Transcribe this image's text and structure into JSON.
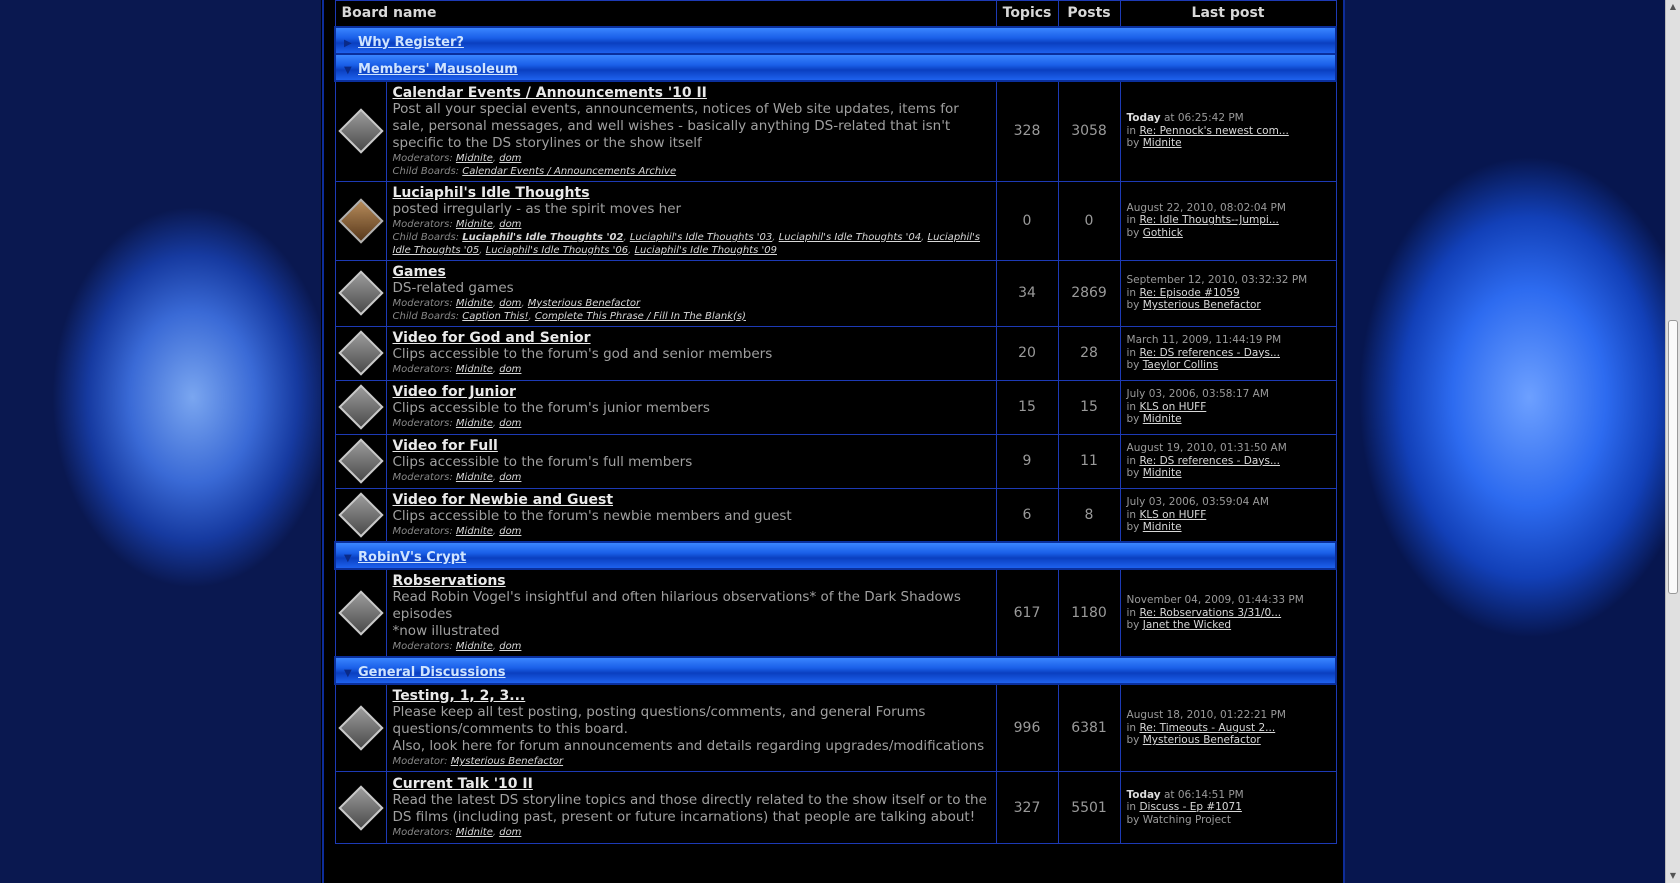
{
  "header": {
    "board_name": "Board name",
    "topics": "Topics",
    "posts": "Posts",
    "last_post": "Last post"
  },
  "categories": {
    "why_register": "Why Register?",
    "members_mausoleum": "Members' Mausoleum",
    "robinv_crypt": "RobinV's Crypt",
    "general_discussions": "General Discussions"
  },
  "labels": {
    "moderators": "Moderators:",
    "moderator": "Moderator:",
    "child_boards": "Child Boards:",
    "in": "in",
    "by": "by",
    "today": "Today"
  },
  "boards": [
    {
      "name": "Calendar Events / Announcements '10 II",
      "desc": "Post all your special events, announcements, notices of Web site updates, items for sale, personal messages, and well wishes - basically anything DS-related that isn't specific to the DS storylines or the show itself",
      "mods": [
        "Midnite",
        "dom"
      ],
      "children": [
        "Calendar Events / Announcements Archive"
      ],
      "topics": "328",
      "posts": "3058",
      "last_date": "at 06:25:42 PM",
      "last_topic": "Re: Pennock's newest com...",
      "last_by": "Midnite"
    },
    {
      "name": "Luciaphil's Idle Thoughts",
      "desc": "posted irregularly - as the spirit moves her",
      "mods": [
        "Midnite",
        "dom"
      ],
      "children": [
        "Luciaphil's Idle Thoughts '02",
        "Luciaphil's Idle Thoughts '03",
        "Luciaphil's Idle Thoughts '04",
        "Luciaphil's Idle Thoughts '05",
        "Luciaphil's Idle Thoughts '06",
        "Luciaphil's Idle Thoughts '09"
      ],
      "topics": "0",
      "posts": "0",
      "last_date": "August 22, 2010, 08:02:04 PM",
      "last_topic": "Re: Idle Thoughts--Jumpi...",
      "last_by": "Gothick"
    },
    {
      "name": "Games",
      "desc": "DS-related games",
      "mods": [
        "Midnite",
        "dom",
        "Mysterious Benefactor"
      ],
      "children": [
        "Caption This!",
        "Complete This Phrase / Fill In The Blank(s)"
      ],
      "topics": "34",
      "posts": "2869",
      "last_date": "September 12, 2010, 03:32:32 PM",
      "last_topic": "Re: Episode #1059",
      "last_by": "Mysterious Benefactor"
    },
    {
      "name": "Video for God and Senior",
      "desc": "Clips accessible to the forum's god and senior members",
      "mods": [
        "Midnite",
        "dom"
      ],
      "topics": "20",
      "posts": "28",
      "last_date": "March 11, 2009, 11:44:19 PM",
      "last_topic": "Re: DS references - Days...",
      "last_by": "Taeylor Collins"
    },
    {
      "name": "Video for Junior",
      "desc": "Clips accessible to the forum's junior members",
      "mods": [
        "Midnite",
        "dom"
      ],
      "topics": "15",
      "posts": "15",
      "last_date": "July 03, 2006, 03:58:17 AM",
      "last_topic": "KLS on HUFF",
      "last_by": "Midnite"
    },
    {
      "name": "Video for Full",
      "desc": "Clips accessible to the forum's full members",
      "mods": [
        "Midnite",
        "dom"
      ],
      "topics": "9",
      "posts": "11",
      "last_date": "August 19, 2010, 01:31:50 AM",
      "last_topic": "Re: DS references - Days...",
      "last_by": "Midnite"
    },
    {
      "name": "Video for Newbie and Guest",
      "desc": "Clips accessible to the forum's newbie members and guest",
      "mods": [
        "Midnite",
        "dom"
      ],
      "topics": "6",
      "posts": "8",
      "last_date": "July 03, 2006, 03:59:04 AM",
      "last_topic": "KLS on HUFF",
      "last_by": "Midnite"
    },
    {
      "name": "Robservations",
      "desc": "Read Robin Vogel's insightful and often hilarious observations* of the Dark Shadows episodes",
      "desc2": "*now illustrated",
      "mods": [
        "Midnite",
        "dom"
      ],
      "topics": "617",
      "posts": "1180",
      "last_date": "November 04, 2009, 01:44:33 PM",
      "last_topic": "Re: Robservations 3/31/0...",
      "last_by": "Janet the Wicked"
    },
    {
      "name": "Testing, 1, 2, 3...",
      "desc": "Please keep all test posting, posting questions/comments, and general Forums questions/comments to this board.",
      "desc2": "Also, look here for forum announcements and details regarding upgrades/modifications",
      "mods": [
        "Mysterious Benefactor"
      ],
      "topics": "996",
      "posts": "6381",
      "last_date": "August 18, 2010, 01:22:21 PM",
      "last_topic": "Re: Timeouts - August 2...",
      "last_by": "Mysterious Benefactor"
    },
    {
      "name": "Current Talk '10 II",
      "desc": "Read the latest DS storyline topics and those directly related to the show itself or to the DS films (including past, present or future incarnations) that people are talking about!",
      "mods": [
        "Midnite",
        "dom"
      ],
      "topics": "327",
      "posts": "5501",
      "last_date": "at 06:14:51 PM",
      "last_topic": "Discuss - Ep #1071",
      "last_by": "Watching Project"
    }
  ]
}
